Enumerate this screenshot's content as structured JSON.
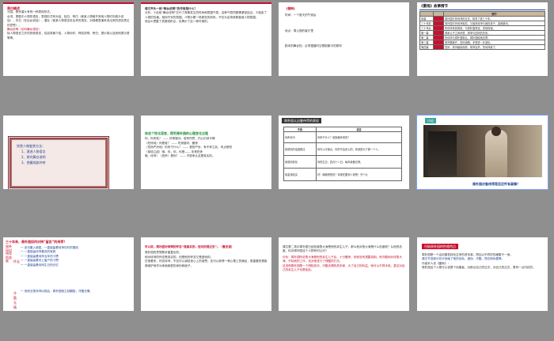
{
  "slides": [
    {
      "number": "13",
      "title": "旁白概述",
      "lines": [
        "冲突、是矛盾斗争的一种表现形式。",
        "台词、是剧中人物的语言，表现形式有对话、独白、旁白（使某人物离开其他人物时向观众说话），内白（在后台说话），潜台（使某人物语言说出来的语言，对观看表演来说出来的语言表达的意思）。",
        "舞台说明（也叫舞台语言）",
        "除人物语言之外的其他语言，包括背景介绍、人物动作、神态说明、旁白、提示语以及其他提示语等等。"
      ]
    },
    {
      "number": "14",
      "question": "课文开头一段“舞台说明”的作用是什么？",
      "lines": [
        "分析：①这段“舞台说明”交代了故事发生的时间和氛围气氛。这种气氛同剧情紧密结合，②渲染了人物的性格，相间不安的氛围，③预示着一场紧张的到来。不仅为这场悲剧营造人物氛围。",
        "而且④透露了资源或积点，也揭示了这一种环境的。"
      ]
    },
    {
      "number": "15",
      "heading": "《雷雨》",
      "lines": [
        "时间：一个夏天的午饭后",
        "地点：周公馆的客厅里",
        "剧本的舞台性：必须遵循时空限制集中的原则"
      ]
    },
    {
      "number": "16",
      "title": "《雷雨》故事情节",
      "headers": [
        "",
        "",
        "情节"
      ],
      "rows": [
        [
          "序幕",
          "",
          "周朴园与鲁侍萍的过去，故事了其三十年。"
        ],
        [
          "三十年前",
          "",
          "周朴园与鲁侍萍相恋，又抛弃侍萍与她的孩子，逼她跳河。"
        ],
        [
          "三十年后",
          "",
          "鲁侍萍来到周家，与周朴园重逢，发现真相。"
        ],
        [
          "第一幕",
          "",
          "周家父子之间矛盾、周萍与四凤的关系。"
        ],
        [
          "第二幕",
          "",
          "鲁侍萍与周朴园相认，周朴园给她支票。"
        ],
        [
          "第三幕",
          "",
          "周萍要离开，四凤追随，矛盾进一步激化。"
        ],
        [
          "第四幕",
          "",
          "四凤、周冲触电而死，周萍自杀，鲁侍萍疯了。"
        ]
      ]
    },
    {
      "number": "17",
      "card_title": "欣赏人物鉴赏方法：",
      "items": [
        "1、演述人物语言",
        "2、探究舞台说明",
        "3、把握戏剧冲突"
      ]
    },
    {
      "number": "18",
      "question": "体会个性化语言，探究周朴园的心理变化过程",
      "lines": [
        "你，你贵姓？ —— 好奇疑问、若有所思、内心仍然平静",
        "（吃惊地）你是谁？ —— 吃惊疑问、震惊",
        "（忽然严厉地）你来干什么？ —— 紧张严厉、有不祥之兆、有点愤怒",
        "（徐徐立起）哦，你，你，你是—— 非常吃惊",
        "哦，侍萍！（低声）是你？ —— 不愿承认这是真实的。"
      ]
    },
    {
      "number": "19",
      "title": "周朴园认出鲁侍萍的表现",
      "headers": [
        "手段",
        "语言"
      ],
      "rows": [
        [
          "厉声责问",
          "你来干什么？谁指使你来的？"
        ],
        [
          "用感情的话语稳住",
          "你可以冷静点，你的不会安心的，你就是为了那一个人。"
        ],
        [
          "用感情软化",
          "你的生日，四月十八日，每年我都记得。"
        ],
        [
          "用金钱收买",
          "好！痛痛快快的！你现在要多少钱吧！开个价"
        ]
      ]
    },
    {
      "number": "20",
      "tag": "讨论",
      "caption": "周朴园对鲁侍萍是否还怀有真情？"
    },
    {
      "number": "21",
      "title": "三十年来，周朴园如何对待“留念”的侍萍？",
      "side": "周朴园对侍萍的态度",
      "lines": [
        "一 多次搬入新居，一直保留着侍萍在时的摆设",
        "一 一直保留侍萍喜欢的家具",
        "一 一直保留着侍萍当年的习惯",
        "一 一直保留着关上窗户的习惯",
        "一 一直保留着侍萍生日的记忆"
      ],
      "labels": [
        "怀念",
        "冷酷无情"
      ],
      "bottom": "一 然而当鲁侍萍出现后，周朴园就立刻翻脸，冷酷无情。"
    },
    {
      "number": "22",
      "lead": "可以说，周朴园对侍萍的怀念“是真实的，但对的是过去”。（鲁迅语）",
      "lines": [
        "周朴园的思想是矛盾复杂的。",
        "他对侍萍的怀念是真实的。但是他的怀念又是虚伪的。",
        "在他看来，怀念侍萍，不仅可以减轻良心上的谴责，还可以获得一种心理上的满足，更重要的是能够维护他作为体面家庭的身份和面子。"
      ]
    },
    {
      "number": "23",
      "question": "课文第二场中周朴园已经知道鲁大海是他的亲生儿子，那么他对鲁大海是什么态度呢？从他的态度，你对周朴园这个人物有何认识？",
      "lines": [
        "分析：周朴园听说鲁大海是他的亲生儿子后，十分震惊，但他没有透露真相。他冷酷地对待鲁大海，开除他的工作，还对他进行了残酷的打击。",
        "这说明周朴园是一个阴险狡诈、冷酷无情的资本家，为了自己的利益，他可以不择手段，甚至对自己的亲生儿子也是如此。"
      ]
    },
    {
      "number": "24",
      "title": "归纳周朴园的性格特点",
      "lines": [
        "周朴园是一个由封建性转化过来的资本家。再加以不同的性格集于一身。",
        "课文节选部分充分刻画了他的自私、虚伪、冷酷、残忍和伪善等。",
        "作者本人说《雷雨》：",
        "周朴园这个人是可以说是个伪善者，对那点自己的过去，对自己的过去，是有一点内疚的。"
      ]
    }
  ],
  "colors": {
    "background": "#8f8f8f",
    "accent_red": "#c8102e",
    "accent_blue": "#1c3f94",
    "panel_tan": "#c9b79c",
    "footer": "#e3e3e3"
  },
  "icons": {
    "footer": "star-icon"
  }
}
